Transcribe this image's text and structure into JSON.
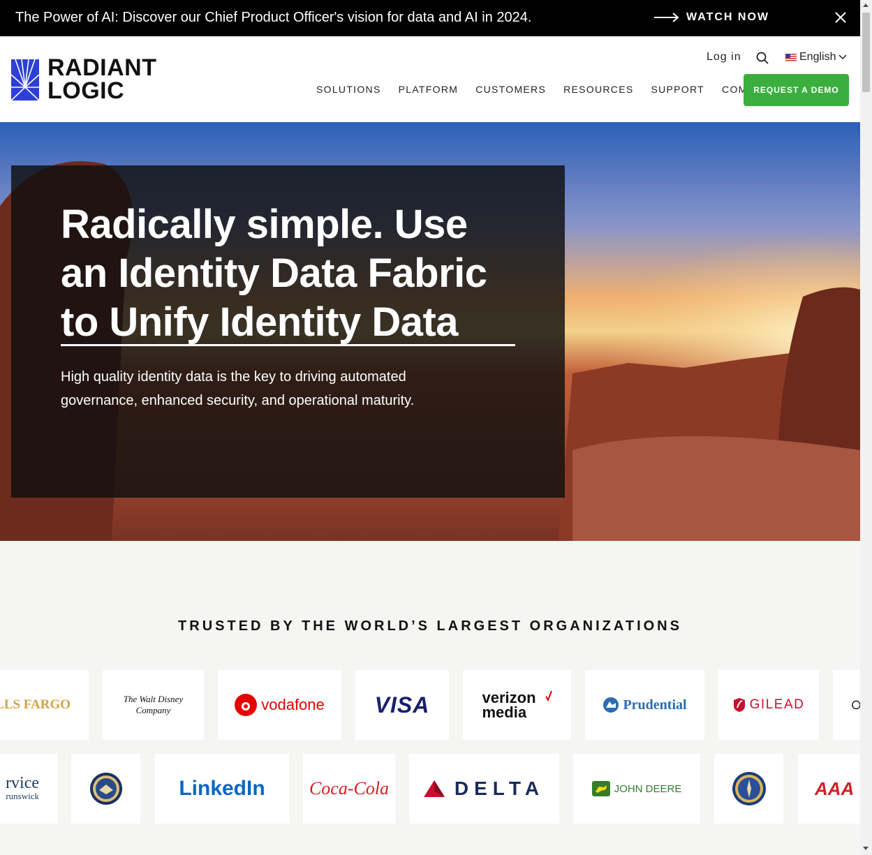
{
  "announcement": {
    "text": "The Power of AI: Discover our Chief Product Officer's vision for data and AI in 2024.",
    "cta": "WATCH NOW"
  },
  "header": {
    "logo_line1": "RADIANT",
    "logo_line2": "LOGIC",
    "login": "Log in",
    "language": "English",
    "nav": [
      "SOLUTIONS",
      "PLATFORM",
      "CUSTOMERS",
      "RESOURCES",
      "SUPPORT",
      "COMPANY"
    ],
    "demo_button": "REQUEST A DEMO",
    "brand_color": "#3cae3f"
  },
  "hero": {
    "title": "Radically simple. Use an Identity Data Fabric to Unify Identity Data",
    "subtitle": "High quality identity data is the key to driving automated governance, enhanced security, and operational maturity."
  },
  "trusted": {
    "title": "TRUSTED BY THE WORLD’S LARGEST ORGANIZATIONS",
    "row1": [
      "LLS FARGO",
      "The Walt Disney Company",
      "vodafone",
      "VISA",
      "verizon media",
      "Prudential",
      "GILEAD"
    ],
    "row2": [
      "rvice",
      "runswick",
      "LinkedIn",
      "Coca-Cola",
      "DELTA",
      "JOHN DEERE",
      "AAA"
    ]
  }
}
